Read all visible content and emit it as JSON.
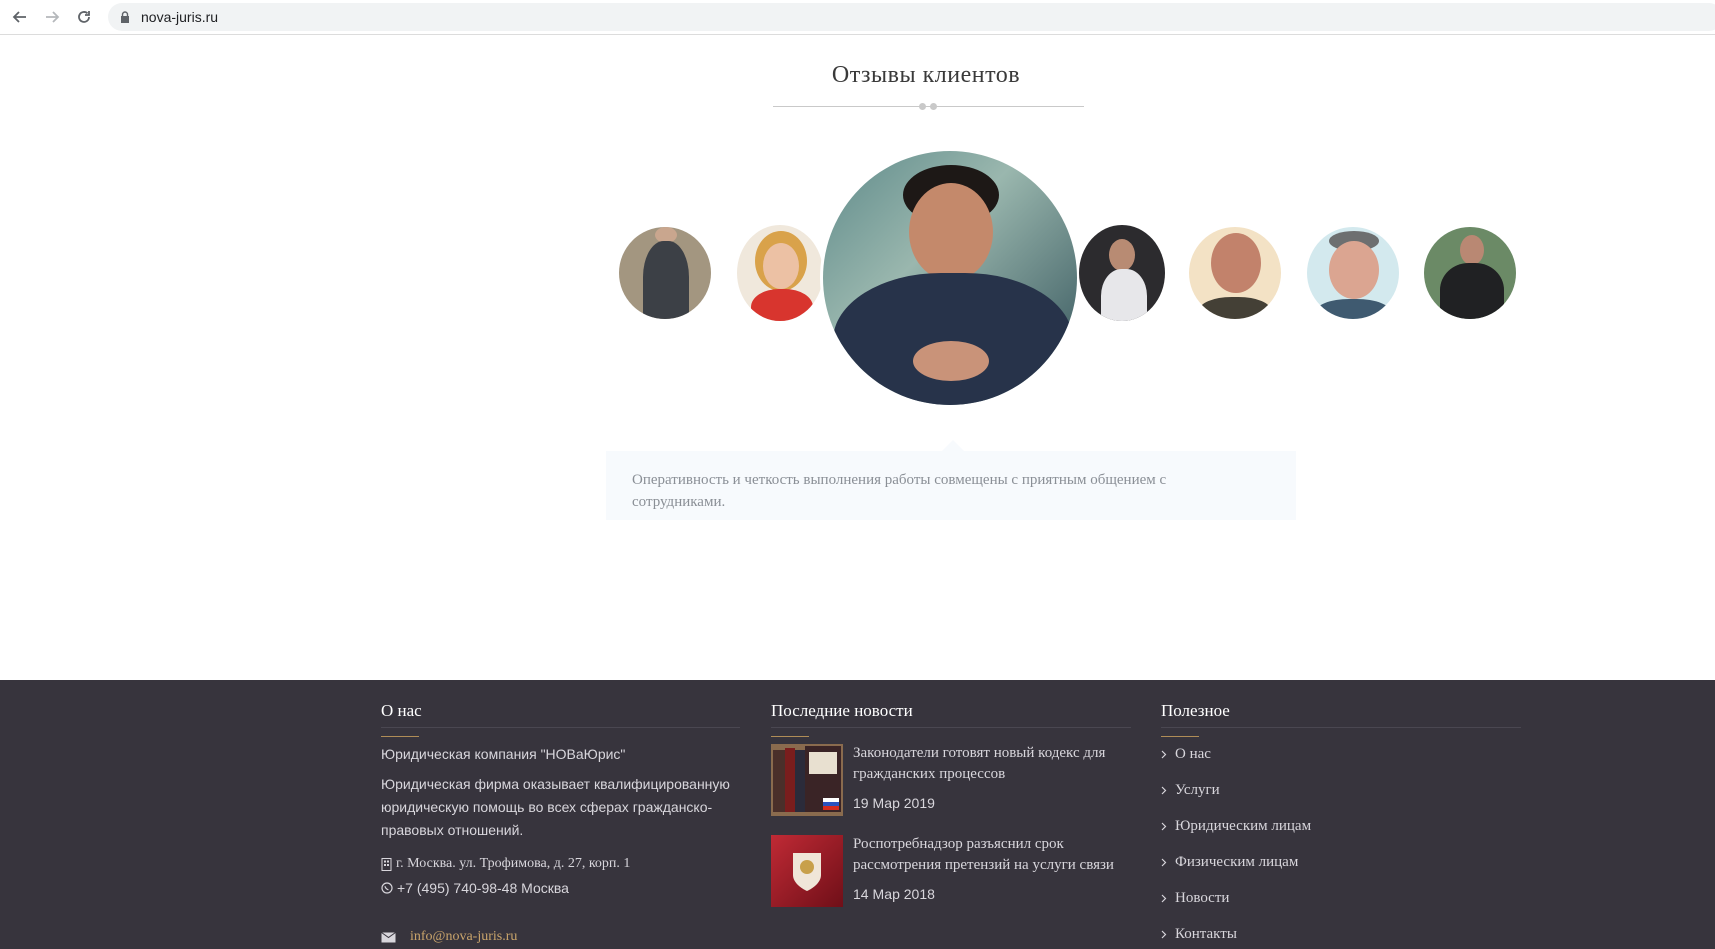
{
  "browser": {
    "url": "nova-juris.ru"
  },
  "testimonials": {
    "title": "Отзывы клиентов",
    "active_quote": "Оперативность и четкость выполнения работы совмещены с приятным общением с сотрудниками."
  },
  "footer": {
    "about": {
      "title": "О нас",
      "company": "Юридическая компания \"НОВаЮрис\"",
      "description": "Юридическая фирма оказывает квалифицированную юридическую помощь во всех сферах гражданско-правовых отношений.",
      "address": "г. Москва. ул. Трофимова, д. 27, корп. 1",
      "phone": "+7 (495) 740-98-48 Москва",
      "email": "info@nova-juris.ru"
    },
    "news": {
      "title": "Последние новости",
      "items": [
        {
          "title": "Законодатели готовят новый кодекс для гражданских процессов",
          "date": "19 Мар 2019"
        },
        {
          "title": "Роспотребнадзор разъяснил срок рассмотрения претензий на услуги связи",
          "date": "14 Мар 2018"
        }
      ]
    },
    "useful": {
      "title": "Полезное",
      "items": [
        "О нас",
        "Услуги",
        "Юридическим лицам",
        "Физическим лицам",
        "Новости",
        "Контакты"
      ]
    }
  },
  "colors": {
    "footer_bg": "#37343d",
    "accent_gold": "#b08d57",
    "link_gold": "#c9a46b",
    "quote_bg": "#f7fafd"
  }
}
